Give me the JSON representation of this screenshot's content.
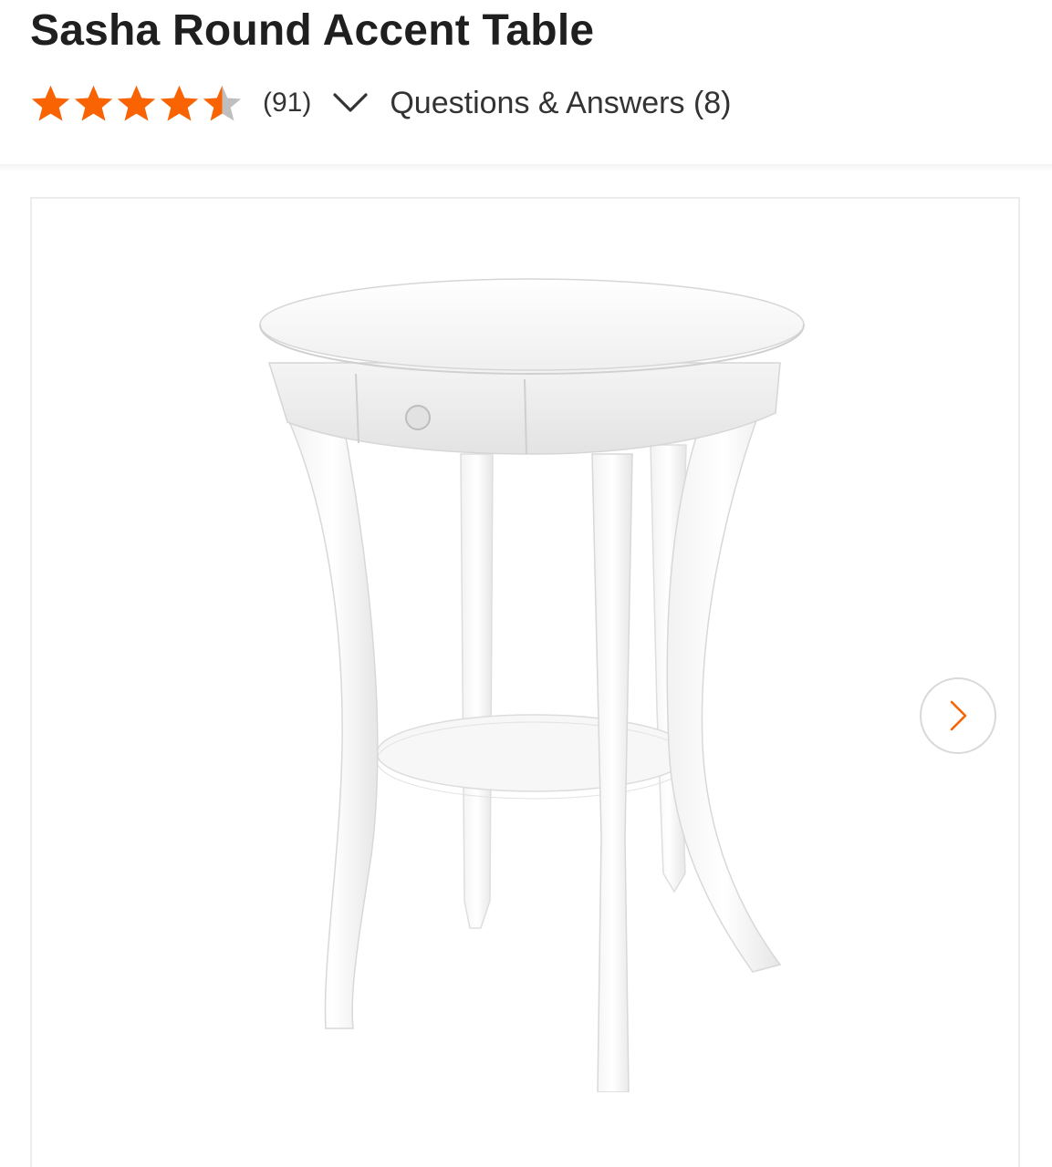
{
  "product": {
    "title": "Sasha Round Accent Table"
  },
  "rating": {
    "stars": 4.5,
    "max_stars": 5,
    "review_count": "(91)",
    "star_color": "#f96302",
    "empty_star_color": "#bfbfbf"
  },
  "qa": {
    "label": "Questions & Answers (8)"
  },
  "icons": {
    "expand": "chevron-down-icon",
    "next": "chevron-right-icon"
  },
  "colors": {
    "accent": "#f96302",
    "text": "#1f1f1f",
    "border": "#ececec"
  }
}
